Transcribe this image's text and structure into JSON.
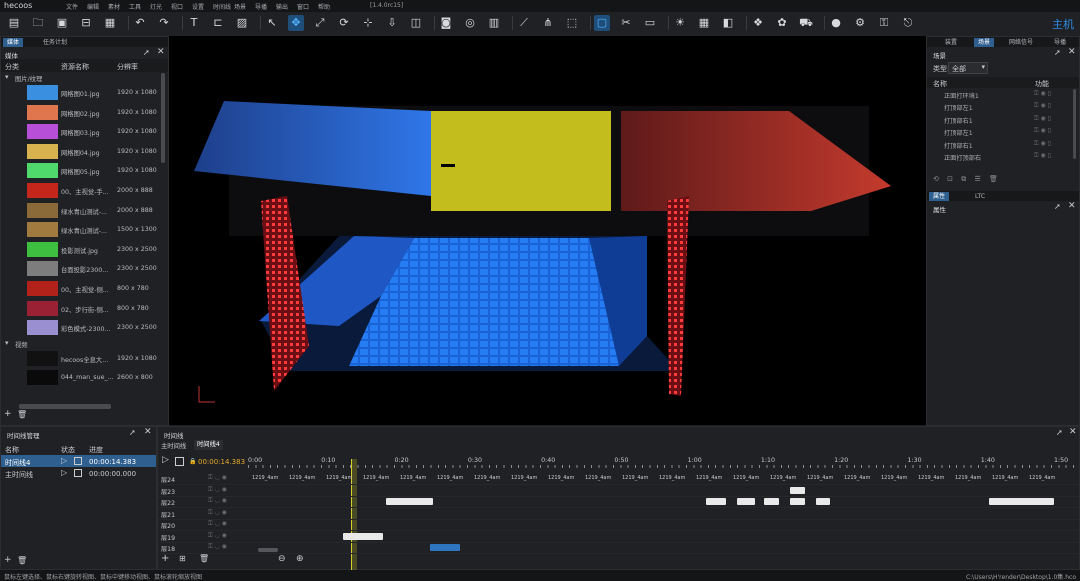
{
  "app": {
    "logo": "hecoos",
    "version": "[1.4.0rc15]",
    "menu": [
      "文件",
      "编辑",
      "素材",
      "工具",
      "灯光",
      "视口",
      "设置",
      "时间线",
      "场景",
      "导播",
      "输出",
      "窗口",
      "帮助"
    ],
    "mode_label": "主机"
  },
  "toolbar": {
    "icons": [
      "new-file-icon",
      "open-folder-icon",
      "save-icon",
      "save-as-icon",
      "archive-icon",
      "undo-icon",
      "redo-icon",
      "text-icon",
      "frame-icon",
      "image-icon",
      "select-arrow-icon",
      "move-icon",
      "scale-icon",
      "rotate-icon",
      "pivot-icon",
      "align-icon",
      "cube-icon",
      "projector-icon",
      "camera-icon",
      "led-icon",
      "laser-icon",
      "network-icon",
      "mapping-icon",
      "view-box-icon",
      "tools-icon",
      "monitor-icon",
      "light-icon",
      "grid-icon",
      "screen-icon",
      "layers-icon",
      "palette-icon",
      "car-icon",
      "record-icon",
      "settings-icon",
      "lock-icon",
      "exit-icon"
    ]
  },
  "left_panel": {
    "tabs": [
      "媒体",
      "任务计划"
    ],
    "title": "媒体",
    "columns": [
      "分类",
      "资源名称",
      "分辨率"
    ],
    "groups": [
      {
        "name": "图片/纹理",
        "items": [
          {
            "name": "网格图01.jpg",
            "res": "1920 x 1080",
            "color": "#3b8fe0"
          },
          {
            "name": "网格图02.jpg",
            "res": "1920 x 1080",
            "color": "#e0764d"
          },
          {
            "name": "网格图03.jpg",
            "res": "1920 x 1080",
            "color": "#b84fd8"
          },
          {
            "name": "网格图04.jpg",
            "res": "1920 x 1080",
            "color": "#d8b24f"
          },
          {
            "name": "网格图05.jpg",
            "res": "1920 x 1080",
            "color": "#4fd86c"
          },
          {
            "name": "00、主视觉-手...",
            "res": "2000 x 888",
            "color": "#c4261c"
          },
          {
            "name": "绿水青山测试-...",
            "res": "2000 x 888",
            "color": "#8b6a3a"
          },
          {
            "name": "绿水青山测试-...",
            "res": "1500 x 1300",
            "color": "#a07a3f"
          },
          {
            "name": "投影测试.jpg",
            "res": "2300 x 2500",
            "color": "#3fbf3f"
          },
          {
            "name": "台面投影2300...",
            "res": "2300 x 2500",
            "color": "#7d7d7d"
          },
          {
            "name": "00、主视觉-侧...",
            "res": "800 x 780",
            "color": "#b3221a"
          },
          {
            "name": "02、步行街-侧...",
            "res": "800 x 780",
            "color": "#992133"
          },
          {
            "name": "彩色模式-2300...",
            "res": "2300 x 2500",
            "color": "#9a8fd0"
          }
        ]
      },
      {
        "name": "视频",
        "items": [
          {
            "name": "hecoos全息大...",
            "res": "1920 x 1080",
            "color": "#111111"
          },
          {
            "name": "044_man_sue_...",
            "res": "2600 x 800",
            "color": "#0a0a0a"
          }
        ]
      }
    ]
  },
  "timeline_manager": {
    "title": "时间线管理",
    "columns": [
      "名称",
      "状态",
      "进度"
    ],
    "rows": [
      {
        "name": "时间线4",
        "progress": "00:00:14.383",
        "selected": true
      },
      {
        "name": "主时间线",
        "progress": "00:00:00.000",
        "selected": false
      }
    ]
  },
  "timeline": {
    "title": "时间线",
    "tabs": [
      "主时间线",
      "时间线4"
    ],
    "current_time": "00:00:14.383",
    "ruler": [
      "0:00",
      "0:10",
      "0:20",
      "0:30",
      "0:40",
      "0:50",
      "1:00",
      "1:10",
      "1:20",
      "1:30",
      "1:40",
      "1:50"
    ],
    "layers": [
      "层24",
      "层23",
      "层22",
      "层21",
      "层20",
      "层19",
      "层18"
    ],
    "marker_text": "1219_4am"
  },
  "scene_panel": {
    "tabs": [
      "场景",
      "网络信号",
      "导播"
    ],
    "top_tab": "场景",
    "filter_label": "类型:",
    "filter_value": "全部",
    "columns": [
      "名称",
      "功能"
    ],
    "items": [
      "正面打环境1",
      "打顶部左1",
      "打顶部右1",
      "打顶部左1",
      "打顶部右1",
      "正面打顶部右"
    ]
  },
  "properties_panel": {
    "tabs": [
      "属性",
      "LTC"
    ],
    "title": "属性"
  },
  "other_top_tab": "装置",
  "status_bar": {
    "hint": "鼠标左键选择、鼠标右键旋转视图、鼠标中键移动视图、鼠标滚轮缩放视图",
    "path": "C:\\Users\\H'render\\Desktop\\1.0集.hco"
  }
}
